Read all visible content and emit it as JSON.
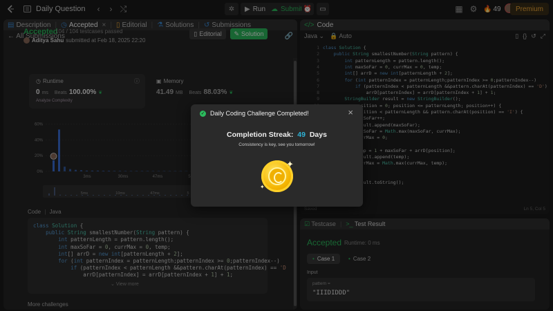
{
  "topbar": {
    "title": "Daily Question",
    "run_label": "Run",
    "submit_label": "Submit",
    "streak_count": "49",
    "premium_label": "Premium"
  },
  "left": {
    "tabs": [
      {
        "label": "Description"
      },
      {
        "label": "Accepted"
      },
      {
        "label": "Editorial"
      },
      {
        "label": "Solutions"
      },
      {
        "label": "Submissions"
      }
    ],
    "all_submissions": "All Submissions",
    "status": "Accepted",
    "tests_passed": "104 / 104 testcases passed",
    "author": "Aditya Sahu",
    "submitted_at": "submitted at Feb 18, 2025 22:20",
    "editorial_btn": "Editorial",
    "solution_btn": "Solution",
    "runtime": {
      "label": "Runtime",
      "value": "0",
      "unit": "ms",
      "beats_label": "Beats",
      "beats_pct": "100.00%",
      "sub": "Analyze Complexity"
    },
    "memory": {
      "label": "Memory",
      "value": "41.49",
      "unit": "MB",
      "beats_label": "Beats",
      "beats_pct": "88.03%"
    },
    "code_label": "Code",
    "code_lang": "Java",
    "code_lines": [
      "class Solution {",
      "    public String smallestNumber(String pattern) {",
      "        int patternLength = pattern.length();",
      "        int maxSoFar = 0, currMax = 0, temp;",
      "        int[] arrD = new int[patternLength + 2];",
      "        for (int patternIndex = patternLength;patternIndex >= 0;patternIndex--)",
      "            if (patternIndex < patternLength &&pattern.charAt(patternIndex) == 'D",
      "                arrD[patternIndex] = arrD[patternIndex + 1] + 1;"
    ],
    "view_more": "View more",
    "more_challenges": "More challenges"
  },
  "chart_data": {
    "type": "bar",
    "yticks": [
      "60%",
      "40%",
      "20%",
      "0%"
    ],
    "xticks": [
      "3ms",
      "30ms",
      "47ms",
      "5"
    ],
    "range_ticks": [
      "5ms",
      "10ms",
      "47ms",
      "5"
    ],
    "values": [
      14,
      53,
      6,
      3,
      2,
      1.5,
      1,
      1,
      1,
      0.8,
      0.8,
      0.6,
      0.6,
      0.5,
      0.5,
      0.5,
      0.5,
      0.5,
      0.4,
      0.4,
      0.4,
      0.4,
      0.4,
      0.4,
      0.3,
      0.3,
      0.3,
      0.3,
      0.3,
      0.3
    ],
    "highlight_index": 0,
    "ylim": [
      0,
      70
    ]
  },
  "editor": {
    "title": "Code",
    "lang": "Java",
    "auto": "Auto",
    "line_numbers": [
      "1",
      "2",
      "3",
      "4",
      "5",
      "6",
      "7",
      "8",
      "9",
      "10",
      "11",
      "12",
      "13",
      "14",
      "15",
      "16",
      "17",
      "18",
      "19",
      "20",
      "21",
      "22",
      "23",
      "24",
      "25"
    ],
    "lines": [
      "class Solution {",
      "    public String smallestNumber(String pattern) {",
      "        int patternLength = pattern.length();",
      "        int maxSoFar = 0, currMax = 0, temp;",
      "        int[] arrD = new int[patternLength + 2];",
      "        for (int patternIndex = patternLength;patternIndex >= 0;patternIndex--)",
      "            if (patternIndex < patternLength &&pattern.charAt(patternIndex) == 'D')",
      "                arrD[patternIndex] = arrD[patternIndex + 1] + 1;",
      "        StringBuilder result = new StringBuilder();",
      "            position = 0; position <= patternLength; position++) {",
      "            position < patternLength && pattern.charAt(position) == 'I') {",
      "            maxSoFar++;",
      "            result.append(maxSoFar);",
      "            maxSoFar = Math.max(maxSoFar, currMax);",
      "            currMax = 0;",
      "            e {",
      "            temp = 1 + maxSoFar + arrD[position];",
      "            result.append(temp);",
      "            currMax = Math.max(currMax, temp);",
      "",
      "",
      "            result.toString();",
      "",
      "",
      ""
    ],
    "status_left": "Saved",
    "status_right": "Ln 5, Col 5"
  },
  "testresult": {
    "tab_testcase": "Testcase",
    "tab_result": "Test Result",
    "status": "Accepted",
    "runtime": "Runtime: 0 ms",
    "case1": "Case 1",
    "case2": "Case 2",
    "input_label": "Input",
    "param": "pattern =",
    "value": "\"IIIDIDDD\""
  },
  "modal": {
    "title": "Daily Coding Challenge Completed!",
    "streak_prefix": "Completion Streak:",
    "streak_num": "49",
    "streak_suffix": "Days",
    "subtitle": "Consistency is key, see you tomorrow!"
  },
  "colors": {
    "accent_green": "#2cbb5d",
    "streak_blue": "#2db2d6",
    "premium_orange": "#f0a93a"
  }
}
